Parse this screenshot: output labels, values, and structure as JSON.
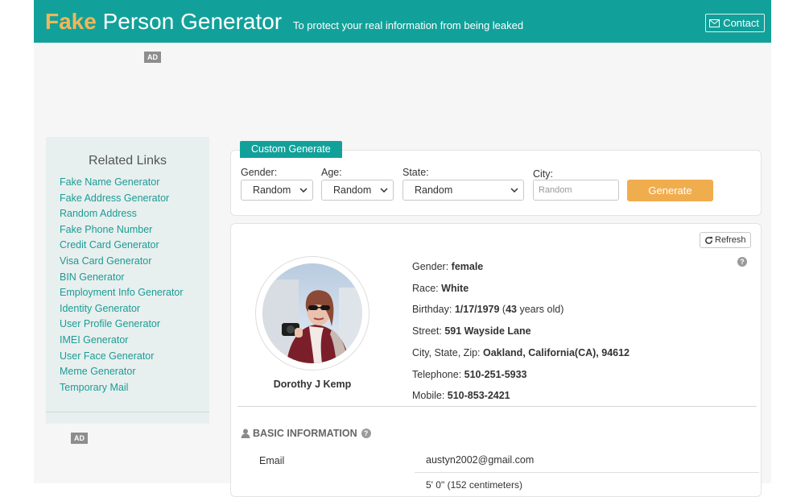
{
  "header": {
    "brand": "Fake",
    "title_rest": " Person Generator",
    "tagline": "To protect your real information from being leaked",
    "contact_label": "Contact",
    "contact_icon": "envelope-icon"
  },
  "ads": {
    "label": "AD"
  },
  "sidebar": {
    "title": "Related Links",
    "links": [
      "Fake Name Generator",
      "Fake Address Generator",
      "Random Address",
      "Fake Phone Number",
      "Credit Card Generator",
      "Visa Card Generator",
      "BIN Generator",
      "Employment Info Generator",
      "Identity Generator",
      "User Profile Generator",
      "IMEI Generator",
      "User Face Generator",
      "Meme Generator",
      "Temporary Mail"
    ]
  },
  "custom": {
    "tab_label": "Custom Generate",
    "gender_label": "Gender:",
    "gender_value": "Random",
    "age_label": "Age:",
    "age_value": "Random",
    "state_label": "State:",
    "state_value": "Random",
    "city_label": "City:",
    "city_placeholder": "Random",
    "generate_label": "Generate"
  },
  "profile": {
    "refresh_label": "Refresh",
    "name": "Dorothy J Kemp",
    "gender_label": "Gender:",
    "gender": "female",
    "race_label": "Race:",
    "race": "White",
    "birthday_label": "Birthday:",
    "birthday": "1/17/1979",
    "age_open": "(",
    "age": "43",
    "age_suffix": "years old)",
    "street_label": "Street:",
    "street": "591 Wayside Lane",
    "city_label": "City, State, Zip:",
    "city": "Oakland, California(CA), 94612",
    "telephone_label": "Telephone:",
    "telephone": "510-251-5933",
    "mobile_label": "Mobile:",
    "mobile": "510-853-2421"
  },
  "basic_info": {
    "heading": "BASIC INFORMATION",
    "email_label": "Email",
    "email_value": "austyn2002@gmail.com",
    "next_value": "5' 0\" (152 centimeters)"
  },
  "colors": {
    "primary": "#12a19a",
    "accent": "#f2b65a",
    "button": "#f0ad4e"
  }
}
